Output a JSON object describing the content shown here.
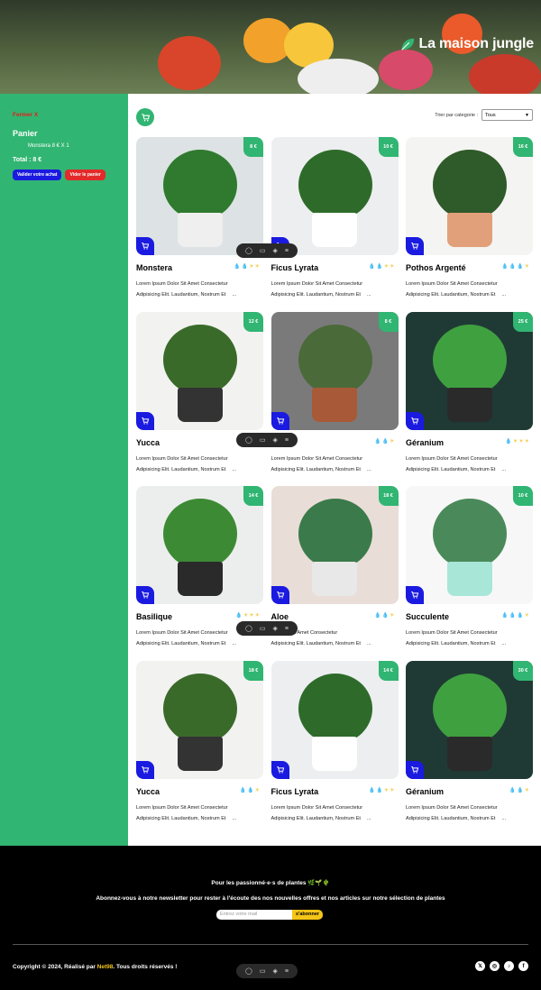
{
  "brand": {
    "title": "La maison jungle"
  },
  "cart": {
    "close_label": "Fermer X",
    "title": "Panier",
    "line": "Monstera 8 € X 1",
    "total": "Total : 8 €",
    "validate_label": "Valider votre achat",
    "empty_label": "Vider le panier"
  },
  "filter": {
    "label": "Trier par categorie :",
    "selected": "Tous"
  },
  "products": [
    {
      "name": "Monstera",
      "price": "8 €",
      "water": 2,
      "light": 2,
      "desc1": "Lorem Ipsum Dolor Sit Amet Consectetur",
      "desc2": "Adipisicing Elit. Laudantium, Nostrum Et",
      "more": "..."
    },
    {
      "name": "Ficus Lyrata",
      "price": "10 €",
      "water": 2,
      "light": 2,
      "desc1": "Lorem Ipsum Dolor Sit Amet Consectetur",
      "desc2": "Adipisicing Elit. Laudantium, Nostrum Et",
      "more": "..."
    },
    {
      "name": "Pothos Argenté",
      "price": "16 €",
      "water": 3,
      "light": 1,
      "desc1": "Lorem Ipsum Dolor Sit Amet Consectetur",
      "desc2": "Adipisicing Elit. Laudantium, Nostrum Et",
      "more": "..."
    },
    {
      "name": "Yucca",
      "price": "12 €",
      "water": 1,
      "light": 0,
      "desc1": "Lorem Ipsum Dolor Sit Amet Consectetur",
      "desc2": "Adipisicing Elit. Laudantium, Nostrum Et",
      "more": "..."
    },
    {
      "name": "",
      "price": "8 €",
      "water": 2,
      "light": 1,
      "desc1": "Lorem Ipsum Dolor Sit Amet Consectetur",
      "desc2": "Adipisicing Elit. Laudantium, Nostrum Et",
      "more": "..."
    },
    {
      "name": "Géranium",
      "price": "25 €",
      "water": 1,
      "light": 3,
      "desc1": "Lorem Ipsum Dolor Sit Amet Consectetur",
      "desc2": "Adipisicing Elit. Laudantium, Nostrum Et",
      "more": "..."
    },
    {
      "name": "Basilique",
      "price": "14 €",
      "water": 1,
      "light": 3,
      "desc1": "Lorem Ipsum Dolor Sit Amet Consectetur",
      "desc2": "Adipisicing Elit. Laudantium, Nostrum Et",
      "more": "..."
    },
    {
      "name": "Aloe",
      "price": "18 €",
      "water": 2,
      "light": 1,
      "desc1": "m Dolor Sit Amet Consectetur",
      "desc2": "Adipisicing Elit. Laudantium, Nostrum Et",
      "more": "..."
    },
    {
      "name": "Succulente",
      "price": "10 €",
      "water": 3,
      "light": 1,
      "desc1": "Lorem Ipsum Dolor Sit Amet Consectetur",
      "desc2": "Adipisicing Elit. Laudantium, Nostrum Et",
      "more": "..."
    },
    {
      "name": "Yucca",
      "price": "18 €",
      "water": 2,
      "light": 1,
      "desc1": "Lorem Ipsum Dolor Sit Amet Consectetur",
      "desc2": "Adipisicing Elit. Laudantium, Nostrum Et",
      "more": "..."
    },
    {
      "name": "Ficus Lyrata",
      "price": "14 €",
      "water": 2,
      "light": 2,
      "desc1": "Lorem Ipsum Dolor Sit Amet Consectetur",
      "desc2": "Adipisicing Elit. Laudantium, Nostrum Et",
      "more": "..."
    },
    {
      "name": "Géranium",
      "price": "30 €",
      "water": 2,
      "light": 1,
      "desc1": "Lorem Ipsum Dolor Sit Amet Consectetur",
      "desc2": "Adipisicing Elit. Laudantium, Nostrum Et",
      "more": "..."
    }
  ],
  "footer": {
    "newsletter_title": "Pour les passionné·e·s de plantes 🌿🌱🌵",
    "newsletter_text": "Abonnez-vous à notre newsletter pour rester à l'écoute des nos nouvelles offres et nos articles sur notre sélection de plantes",
    "email_placeholder": "Entrez votre mail",
    "subscribe_label": "s'abonner",
    "copyright_prefix": "Copyright © 2024, Réalisé par ",
    "copyright_author": "Net98",
    "copyright_suffix": ". Tous droits réservés !"
  },
  "colors": {
    "green": "#31b572",
    "blue": "#1a1ae0",
    "red": "#e22a2a",
    "yellow": "#f5c518"
  }
}
